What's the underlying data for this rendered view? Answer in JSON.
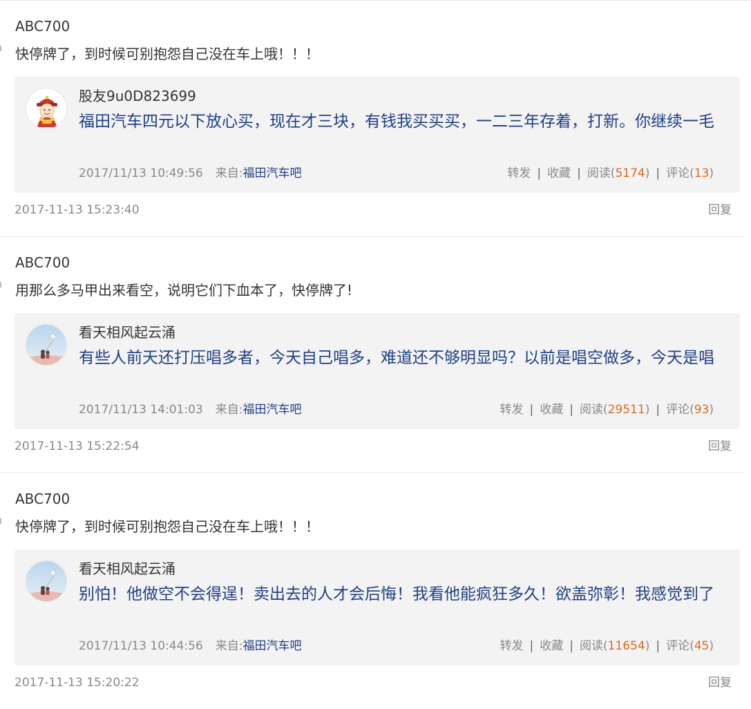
{
  "comments": [
    {
      "username": "ABC700",
      "text": "快停牌了，到时候可别抱怨自己没在车上哦！！！",
      "quote": {
        "avatar_icon": "fortune-god-avatar-icon",
        "username": "股友9u0D823699",
        "text": "福田汽车四元以下放心买，现在才三块，有钱我买买买，一二三年存着，打新。你继续一毛",
        "datetime": "2017/11/13 10:49:56",
        "from_label": "来自:",
        "source": "福田汽车吧",
        "forward_label": "转发",
        "favorite_label": "收藏",
        "read_label": "阅读(",
        "read_count": "5174",
        "read_close": ")",
        "comment_label": "评论(",
        "comment_count": "13",
        "comment_close": ")",
        "separator": "|"
      },
      "post_time": "2017-11-13 15:23:40",
      "reply_label": "回复"
    },
    {
      "username": "ABC700",
      "text": "用那么多马甲出来看空，说明它们下血本了，快停牌了!",
      "quote": {
        "avatar_icon": "kite-sky-avatar-icon",
        "username": "看天相风起云涌",
        "text": "有些人前天还打压唱多者，今天自己唱多，难道还不够明显吗？以前是唱空做多，今天是唱",
        "datetime": "2017/11/13 14:01:03",
        "from_label": "来自:",
        "source": "福田汽车吧",
        "forward_label": "转发",
        "favorite_label": "收藏",
        "read_label": "阅读(",
        "read_count": "29511",
        "read_close": ")",
        "comment_label": "评论(",
        "comment_count": "93",
        "comment_close": ")",
        "separator": "|"
      },
      "post_time": "2017-11-13 15:22:54",
      "reply_label": "回复"
    },
    {
      "username": "ABC700",
      "text": "快停牌了，到时候可别抱怨自己没在车上哦！！！",
      "quote": {
        "avatar_icon": "kite-sky-avatar-icon",
        "username": "看天相风起云涌",
        "text": "别怕！他做空不会得逞！卖出去的人才会后悔！我看他能疯狂多久！欲盖弥彰！我感觉到了",
        "datetime": "2017/11/13 10:44:56",
        "from_label": "来自:",
        "source": "福田汽车吧",
        "forward_label": "转发",
        "favorite_label": "收藏",
        "read_label": "阅读(",
        "read_count": "11654",
        "read_close": ")",
        "comment_label": "评论(",
        "comment_count": "45",
        "comment_close": ")",
        "separator": "|"
      },
      "post_time": "2017-11-13 15:20:22",
      "reply_label": "回复"
    }
  ],
  "colors": {
    "link_blue": "#1f3f86",
    "count_orange": "#e0661e",
    "meta_gray": "#888888",
    "quote_bg": "#f3f3f3"
  }
}
